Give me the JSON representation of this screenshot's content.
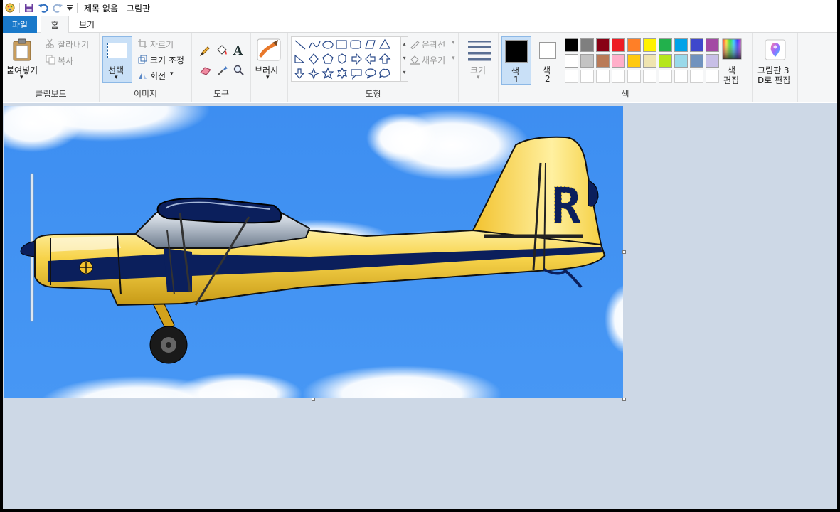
{
  "window": {
    "title": "제목 없음 - 그림판"
  },
  "tabs": {
    "file": "파일",
    "home": "홈",
    "view": "보기"
  },
  "clipboard": {
    "paste": "붙여넣기",
    "cut": "잘라내기",
    "copy": "복사",
    "label": "클립보드"
  },
  "image": {
    "select": "선택",
    "crop": "자르기",
    "resize": "크기 조정",
    "rotate": "회전",
    "label": "이미지"
  },
  "tools": {
    "label": "도구"
  },
  "brushes": {
    "label": "브러시"
  },
  "shapes": {
    "outline": "윤곽선",
    "fill": "채우기",
    "label": "도형"
  },
  "size": {
    "label": "크기"
  },
  "colors": {
    "color1": "색\n1",
    "color1_a": "색",
    "color1_b": "1",
    "color2_a": "색",
    "color2_b": "2",
    "edit_a": "색",
    "edit_b": "편집",
    "label": "색",
    "color1_value": "#000000",
    "color2_value": "#ffffff",
    "palette_row1": [
      "#000000",
      "#7f7f7f",
      "#880015",
      "#ed1c24",
      "#ff7f27",
      "#fff200",
      "#22b14c",
      "#00a2e8",
      "#3f48cc",
      "#a349a4"
    ],
    "palette_row2": [
      "#ffffff",
      "#c3c3c3",
      "#b97a57",
      "#ffaec9",
      "#ffc90e",
      "#efe4b0",
      "#b5e61d",
      "#99d9ea",
      "#7092be",
      "#c8bfe7"
    ]
  },
  "paint3d": {
    "line1": "그림판 3",
    "line2": "D로 편집"
  },
  "canvas": {
    "plane_tail_letter": "R"
  }
}
